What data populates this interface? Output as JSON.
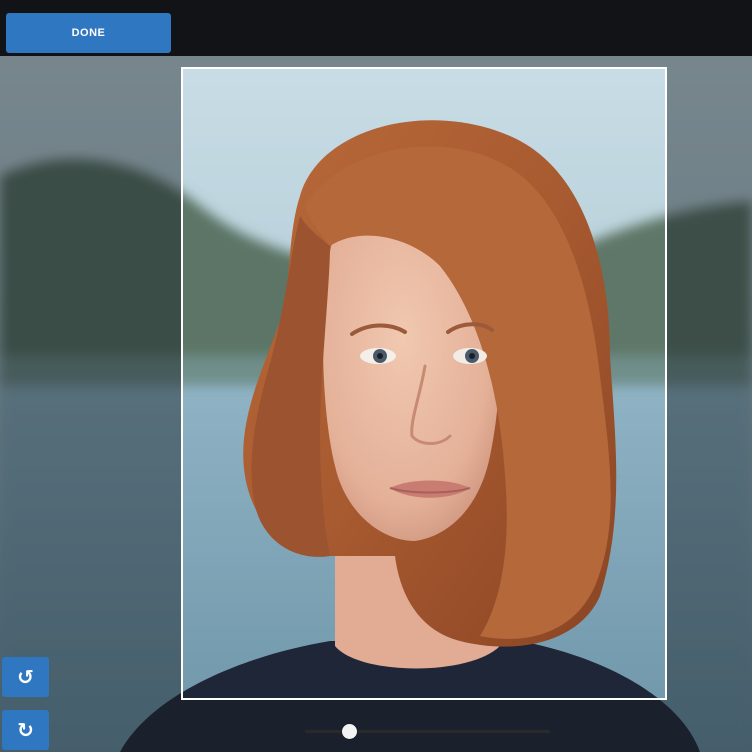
{
  "toolbar": {
    "done_label": "DONE"
  },
  "editor": {
    "rotate_left_icon": "rotate-ccw-icon",
    "rotate_left_glyph": "↺",
    "rotate_right_icon": "rotate-cw-icon",
    "rotate_right_glyph": "↻",
    "zoom_level": 0.18
  },
  "colors": {
    "accent": "#2f77c0",
    "topbar": "#111316",
    "crop_border": "#ffffff"
  }
}
